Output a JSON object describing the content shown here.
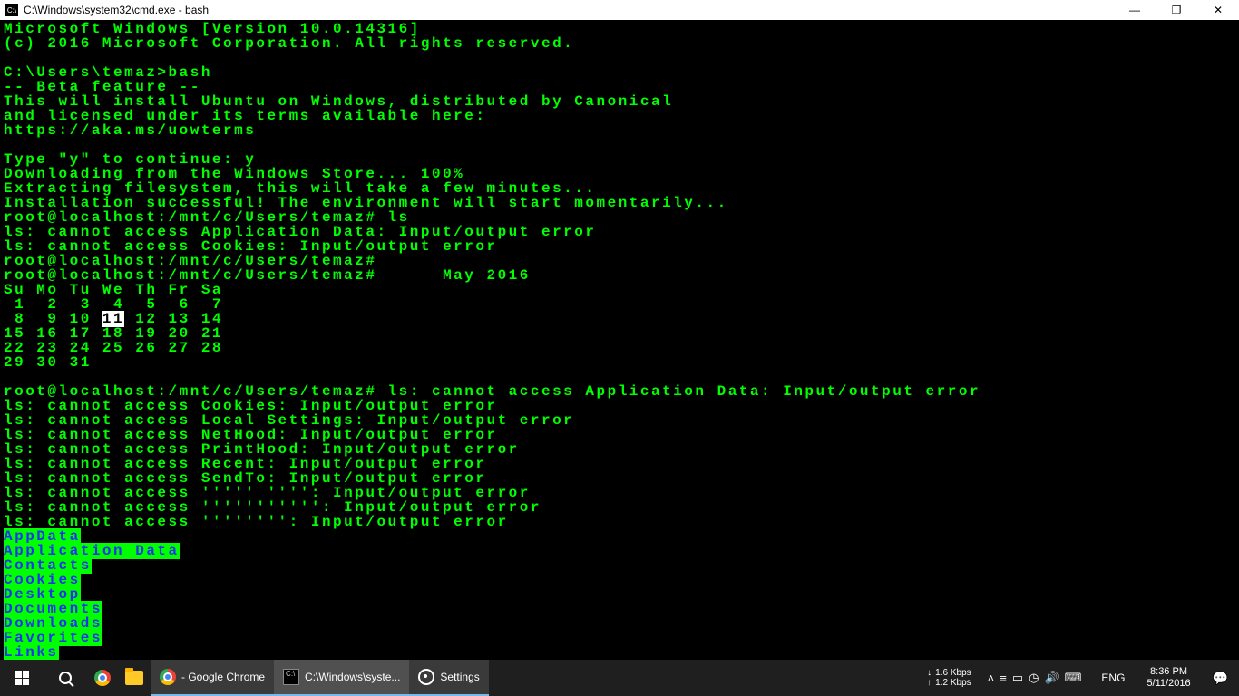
{
  "window": {
    "title": "C:\\Windows\\system32\\cmd.exe - bash"
  },
  "terminal": {
    "lines": [
      "Microsoft Windows [Version 10.0.14316]",
      "(c) 2016 Microsoft Corporation. All rights reserved.",
      "",
      "C:\\Users\\temaz>bash",
      "-- Beta feature --",
      "This will install Ubuntu on Windows, distributed by Canonical",
      "and licensed under its terms available here:",
      "https://aka.ms/uowterms",
      "",
      "Type \"y\" to continue: y",
      "Downloading from the Windows Store... 100%",
      "Extracting filesystem, this will take a few minutes...",
      "Installation successful! The environment will start momentarily...",
      "root@localhost:/mnt/c/Users/temaz# ls",
      "ls: cannot access Application Data: Input/output error",
      "ls: cannot access Cookies: Input/output error",
      "root@localhost:/mnt/c/Users/temaz#",
      "root@localhost:/mnt/c/Users/temaz#      May 2016",
      "Su Mo Tu We Th Fr Sa",
      " 1  2  3  4  5  6  7",
      " 8  9 10 ",
      "11",
      " 12 13 14",
      "15 16 17 18 19 20 21",
      "22 23 24 25 26 27 28",
      "29 30 31",
      "",
      "root@localhost:/mnt/c/Users/temaz# ls: cannot access Application Data: Input/output error",
      "ls: cannot access Cookies: Input/output error",
      "ls: cannot access Local Settings: Input/output error",
      "ls: cannot access NetHood: Input/output error",
      "ls: cannot access PrintHood: Input/output error",
      "ls: cannot access Recent: Input/output error",
      "ls: cannot access SendTo: Input/output error",
      "ls: cannot access ''''' '''': Input/output error",
      "ls: cannot access ''''''''''': Input/output error",
      "ls: cannot access '''''''': Input/output error"
    ],
    "dirs": [
      "AppData",
      "Application Data",
      "Contacts",
      "Cookies",
      "Desktop",
      "Documents",
      "Downloads",
      "Favorites",
      "Links"
    ]
  },
  "taskbar": {
    "chrome_label": "- Google Chrome",
    "cmd_label": "C:\\Windows\\syste...",
    "settings_label": "Settings",
    "net_down": "1.6 Kbps",
    "net_up": "1.2 Kbps",
    "lang": "ENG",
    "time": "8:36 PM",
    "date": "5/11/2016"
  }
}
